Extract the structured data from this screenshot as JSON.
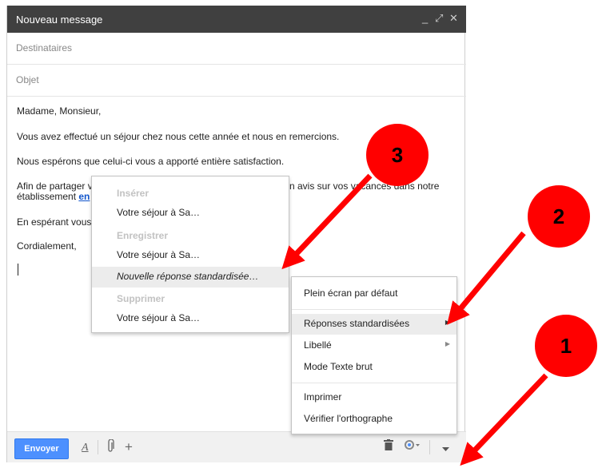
{
  "compose": {
    "title": "Nouveau message",
    "recipients_placeholder": "Destinataires",
    "subject_placeholder": "Objet",
    "body": {
      "line1": "Madame, Monsieur,",
      "line2": "Vous avez effectué un séjour chez nous cette année et nous en remercions.",
      "line3": "Nous espérons que celui-ci vous a apporté entière satisfaction.",
      "line4a_start": "Afin de partager v",
      "line4a_end": "n avis sur vos vacances dans notre",
      "line4b": "établissement ",
      "line4b_link": "en",
      "line5": "En espérant vous",
      "line6": "Cordialement,"
    },
    "toolbar": {
      "send_label": "Envoyer"
    },
    "window_controls": {
      "minimize": "_",
      "expand": "⤢",
      "close": "✕"
    }
  },
  "canned_menu": {
    "sections": {
      "insert": "Insérer",
      "save": "Enregistrer",
      "delete": "Supprimer"
    },
    "items": {
      "insert_item": "Votre séjour à Sa…",
      "save_item": "Votre séjour à Sa…",
      "new_response": "Nouvelle réponse standardisée…",
      "delete_item": "Votre séjour à Sa…"
    }
  },
  "more_menu": {
    "items": [
      {
        "label": "Plein écran par défaut"
      },
      {
        "label": "Réponses standardisées"
      },
      {
        "label": "Libellé"
      },
      {
        "label": "Mode Texte brut"
      },
      {
        "label": "Imprimer"
      },
      {
        "label": "Vérifier l'orthographe"
      }
    ]
  },
  "annotations": {
    "badge1": "1",
    "badge2": "2",
    "badge3": "3",
    "color": "#ff0000"
  }
}
